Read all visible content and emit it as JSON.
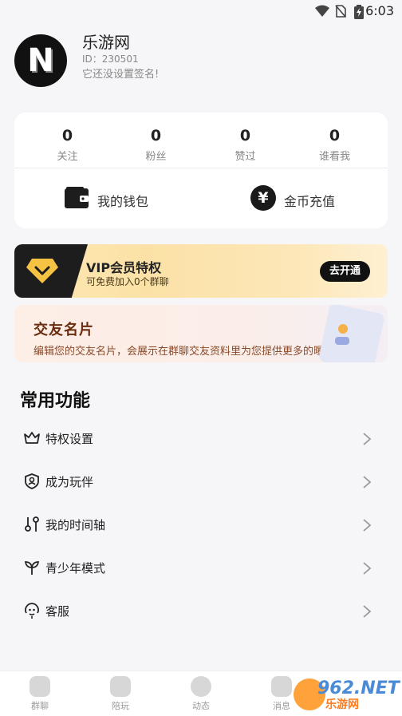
{
  "status_bar": {
    "time": "6:03"
  },
  "profile": {
    "name": "乐游网",
    "id_text": "ID：230501",
    "signature": "它还没设置签名!",
    "avatar_letter": "N"
  },
  "stats": [
    {
      "value": "0",
      "label": "关注"
    },
    {
      "value": "0",
      "label": "粉丝"
    },
    {
      "value": "0",
      "label": "赞过"
    },
    {
      "value": "0",
      "label": "谁看我"
    }
  ],
  "wallet": {
    "label": "我的钱包"
  },
  "coin": {
    "label": "金币充值",
    "symbol": "¥"
  },
  "vip": {
    "title": "VIP会员特权",
    "subtitle": "可免费加入0个群聊",
    "button": "去开通"
  },
  "friend_card": {
    "title": "交友名片",
    "subtitle": "编辑您的交友名片，会展示在群聊交友资料里为您提供更多的曝光"
  },
  "common": {
    "title": "常用功能",
    "items": [
      {
        "label": "特权设置",
        "icon": "crown-icon"
      },
      {
        "label": "成为玩伴",
        "icon": "shield-user-icon"
      },
      {
        "label": "我的时间轴",
        "icon": "timeline-icon"
      },
      {
        "label": "青少年模式",
        "icon": "sprout-icon"
      },
      {
        "label": "客服",
        "icon": "customer-service-icon"
      }
    ]
  },
  "tabbar": [
    {
      "label": "群聊"
    },
    {
      "label": "陪玩"
    },
    {
      "label": "动态"
    },
    {
      "label": "消息"
    }
  ],
  "watermark": {
    "line1": "962.NET",
    "line2": "乐游网"
  },
  "colors": {
    "vip_gold": "#f6c244",
    "dark": "#1d1d1d",
    "friend_title": "#6a2c0e"
  }
}
